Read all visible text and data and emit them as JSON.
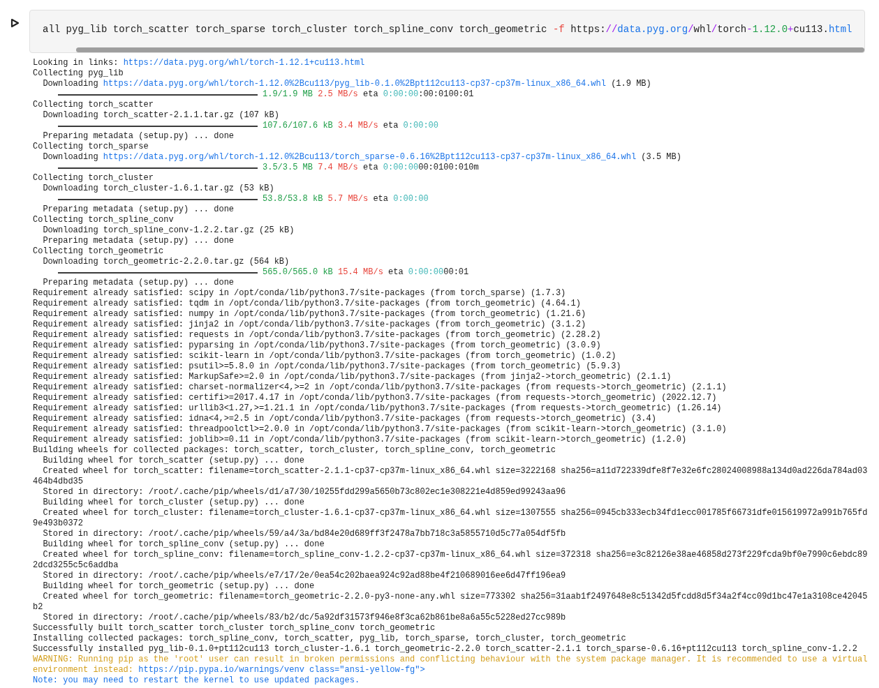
{
  "cell": {
    "command": [
      {
        "kind": "plain",
        "text": "all pyg_lib torch_scatter torch_sparse torch_cluster torch_spline_conv torch_geometric "
      },
      {
        "kind": "red",
        "text": "-f"
      },
      {
        "kind": "plain",
        "text": " https:"
      },
      {
        "kind": "purple",
        "text": "//"
      },
      {
        "kind": "link",
        "text": "data.pyg.org"
      },
      {
        "kind": "purple",
        "text": "/"
      },
      {
        "kind": "plain",
        "text": "whl"
      },
      {
        "kind": "purple",
        "text": "/"
      },
      {
        "kind": "plain",
        "text": "torch"
      },
      {
        "kind": "purple",
        "text": "-"
      },
      {
        "kind": "green",
        "text": "1.12.0"
      },
      {
        "kind": "purple",
        "text": "+"
      },
      {
        "kind": "plain",
        "text": "cu113."
      },
      {
        "kind": "link",
        "text": "html"
      }
    ]
  },
  "output": [
    {
      "kind": "text",
      "segments": [
        {
          "kind": "plain",
          "text": "Looking in links: "
        },
        {
          "kind": "link",
          "text": "https://data.pyg.org/whl/torch-1.12.1+cu113.html"
        }
      ]
    },
    {
      "kind": "text",
      "segments": [
        {
          "kind": "plain",
          "text": "Collecting pyg_lib"
        }
      ]
    },
    {
      "kind": "text",
      "segments": [
        {
          "kind": "plain",
          "text": "  Downloading "
        },
        {
          "kind": "link",
          "text": "https://data.pyg.org/whl/torch-1.12.0%2Bcu113/pyg_lib-0.1.0%2Bpt112cu113-cp37-cp37m-linux_x86_64.whl"
        },
        {
          "kind": "plain",
          "text": " (1.9 MB)"
        }
      ]
    },
    {
      "kind": "progress",
      "level": 1,
      "segments": [
        {
          "kind": "green",
          "text": "1.9/1.9 MB"
        },
        {
          "kind": "red",
          "text": "2.5 MB/s"
        },
        {
          "kind": "plain",
          "text": "eta"
        },
        {
          "kind": "cyan",
          "text": "0:00:00"
        },
        {
          "kind": "plain",
          "text": ":00:0100:01"
        }
      ]
    },
    {
      "kind": "text",
      "segments": [
        {
          "kind": "plain",
          "text": "Collecting torch_scatter"
        }
      ]
    },
    {
      "kind": "text",
      "segments": [
        {
          "kind": "plain",
          "text": "  Downloading torch_scatter-2.1.1.tar.gz (107 kB)"
        }
      ]
    },
    {
      "kind": "progress",
      "level": 1,
      "segments": [
        {
          "kind": "green",
          "text": "107.6/107.6 kB"
        },
        {
          "kind": "red",
          "text": "3.4 MB/s"
        },
        {
          "kind": "plain",
          "text": "eta"
        },
        {
          "kind": "cyan",
          "text": "0:00:00"
        }
      ]
    },
    {
      "kind": "text",
      "segments": [
        {
          "kind": "plain",
          "text": "  Preparing metadata (setup.py) ... done"
        }
      ]
    },
    {
      "kind": "text",
      "segments": [
        {
          "kind": "plain",
          "text": "Collecting torch_sparse"
        }
      ]
    },
    {
      "kind": "text",
      "segments": [
        {
          "kind": "plain",
          "text": "  Downloading "
        },
        {
          "kind": "link",
          "text": "https://data.pyg.org/whl/torch-1.12.0%2Bcu113/torch_sparse-0.6.16%2Bpt112cu113-cp37-cp37m-linux_x86_64.whl"
        },
        {
          "kind": "plain",
          "text": " (3.5 MB)"
        }
      ]
    },
    {
      "kind": "progress",
      "level": 1,
      "segments": [
        {
          "kind": "green",
          "text": "3.5/3.5 MB"
        },
        {
          "kind": "red",
          "text": "7.4 MB/s"
        },
        {
          "kind": "plain",
          "text": "eta"
        },
        {
          "kind": "cyan",
          "text": "0:00:00"
        },
        {
          "kind": "plain",
          "text": "00:0100:010m"
        }
      ]
    },
    {
      "kind": "text",
      "segments": [
        {
          "kind": "plain",
          "text": "Collecting torch_cluster"
        }
      ]
    },
    {
      "kind": "text",
      "segments": [
        {
          "kind": "plain",
          "text": "  Downloading torch_cluster-1.6.1.tar.gz (53 kB)"
        }
      ]
    },
    {
      "kind": "progress",
      "level": 1,
      "segments": [
        {
          "kind": "green",
          "text": "53.8/53.8 kB"
        },
        {
          "kind": "red",
          "text": "5.7 MB/s"
        },
        {
          "kind": "plain",
          "text": "eta"
        },
        {
          "kind": "cyan",
          "text": "0:00:00"
        }
      ]
    },
    {
      "kind": "text",
      "segments": [
        {
          "kind": "plain",
          "text": "  Preparing metadata (setup.py) ... done"
        }
      ]
    },
    {
      "kind": "text",
      "segments": [
        {
          "kind": "plain",
          "text": "Collecting torch_spline_conv"
        }
      ]
    },
    {
      "kind": "text",
      "segments": [
        {
          "kind": "plain",
          "text": "  Downloading torch_spline_conv-1.2.2.tar.gz (25 kB)"
        }
      ]
    },
    {
      "kind": "text",
      "segments": [
        {
          "kind": "plain",
          "text": "  Preparing metadata (setup.py) ... done"
        }
      ]
    },
    {
      "kind": "text",
      "segments": [
        {
          "kind": "plain",
          "text": "Collecting torch_geometric"
        }
      ]
    },
    {
      "kind": "text",
      "segments": [
        {
          "kind": "plain",
          "text": "  Downloading torch_geometric-2.2.0.tar.gz (564 kB)"
        }
      ]
    },
    {
      "kind": "progress",
      "level": 1,
      "segments": [
        {
          "kind": "green",
          "text": "565.0/565.0 kB"
        },
        {
          "kind": "red",
          "text": "15.4 MB/s"
        },
        {
          "kind": "plain",
          "text": "eta"
        },
        {
          "kind": "cyan",
          "text": "0:00:00"
        },
        {
          "kind": "plain",
          "text": "00:01"
        }
      ]
    },
    {
      "kind": "text",
      "segments": [
        {
          "kind": "plain",
          "text": "  Preparing metadata (setup.py) ... done"
        }
      ]
    },
    {
      "kind": "text",
      "segments": [
        {
          "kind": "plain",
          "text": "Requirement already satisfied: scipy in /opt/conda/lib/python3.7/site-packages (from torch_sparse) (1.7.3)"
        }
      ]
    },
    {
      "kind": "text",
      "segments": [
        {
          "kind": "plain",
          "text": "Requirement already satisfied: tqdm in /opt/conda/lib/python3.7/site-packages (from torch_geometric) (4.64.1)"
        }
      ]
    },
    {
      "kind": "text",
      "segments": [
        {
          "kind": "plain",
          "text": "Requirement already satisfied: numpy in /opt/conda/lib/python3.7/site-packages (from torch_geometric) (1.21.6)"
        }
      ]
    },
    {
      "kind": "text",
      "segments": [
        {
          "kind": "plain",
          "text": "Requirement already satisfied: jinja2 in /opt/conda/lib/python3.7/site-packages (from torch_geometric) (3.1.2)"
        }
      ]
    },
    {
      "kind": "text",
      "segments": [
        {
          "kind": "plain",
          "text": "Requirement already satisfied: requests in /opt/conda/lib/python3.7/site-packages (from torch_geometric) (2.28.2)"
        }
      ]
    },
    {
      "kind": "text",
      "segments": [
        {
          "kind": "plain",
          "text": "Requirement already satisfied: pyparsing in /opt/conda/lib/python3.7/site-packages (from torch_geometric) (3.0.9)"
        }
      ]
    },
    {
      "kind": "text",
      "segments": [
        {
          "kind": "plain",
          "text": "Requirement already satisfied: scikit-learn in /opt/conda/lib/python3.7/site-packages (from torch_geometric) (1.0.2)"
        }
      ]
    },
    {
      "kind": "text",
      "segments": [
        {
          "kind": "plain",
          "text": "Requirement already satisfied: psutil>=5.8.0 in /opt/conda/lib/python3.7/site-packages (from torch_geometric) (5.9.3)"
        }
      ]
    },
    {
      "kind": "text",
      "segments": [
        {
          "kind": "plain",
          "text": "Requirement already satisfied: MarkupSafe>=2.0 in /opt/conda/lib/python3.7/site-packages (from jinja2->torch_geometric) (2.1.1)"
        }
      ]
    },
    {
      "kind": "text",
      "segments": [
        {
          "kind": "plain",
          "text": "Requirement already satisfied: charset-normalizer<4,>=2 in /opt/conda/lib/python3.7/site-packages (from requests->torch_geometric) (2.1.1)"
        }
      ]
    },
    {
      "kind": "text",
      "segments": [
        {
          "kind": "plain",
          "text": "Requirement already satisfied: certifi>=2017.4.17 in /opt/conda/lib/python3.7/site-packages (from requests->torch_geometric) (2022.12.7)"
        }
      ]
    },
    {
      "kind": "text",
      "segments": [
        {
          "kind": "plain",
          "text": "Requirement already satisfied: urllib3<1.27,>=1.21.1 in /opt/conda/lib/python3.7/site-packages (from requests->torch_geometric) (1.26.14)"
        }
      ]
    },
    {
      "kind": "text",
      "segments": [
        {
          "kind": "plain",
          "text": "Requirement already satisfied: idna<4,>=2.5 in /opt/conda/lib/python3.7/site-packages (from requests->torch_geometric) (3.4)"
        }
      ]
    },
    {
      "kind": "text",
      "segments": [
        {
          "kind": "plain",
          "text": "Requirement already satisfied: threadpoolctl>=2.0.0 in /opt/conda/lib/python3.7/site-packages (from scikit-learn->torch_geometric) (3.1.0)"
        }
      ]
    },
    {
      "kind": "text",
      "segments": [
        {
          "kind": "plain",
          "text": "Requirement already satisfied: joblib>=0.11 in /opt/conda/lib/python3.7/site-packages (from scikit-learn->torch_geometric) (1.2.0)"
        }
      ]
    },
    {
      "kind": "text",
      "segments": [
        {
          "kind": "plain",
          "text": "Building wheels for collected packages: torch_scatter, torch_cluster, torch_spline_conv, torch_geometric"
        }
      ]
    },
    {
      "kind": "text",
      "segments": [
        {
          "kind": "plain",
          "text": "  Building wheel for torch_scatter (setup.py) ... done"
        }
      ]
    },
    {
      "kind": "text",
      "segments": [
        {
          "kind": "plain",
          "text": "  Created wheel for torch_scatter: filename=torch_scatter-2.1.1-cp37-cp37m-linux_x86_64.whl size=3222168 sha256=a11d722339dfe8f7e32e6fc28024008988a134d0ad226da784ad03"
        }
      ]
    },
    {
      "kind": "text",
      "segments": [
        {
          "kind": "plain",
          "text": "464b4dbd35"
        }
      ]
    },
    {
      "kind": "text",
      "segments": [
        {
          "kind": "plain",
          "text": "  Stored in directory: /root/.cache/pip/wheels/d1/a7/30/10255fdd299a5650b73c802ec1e308221e4d859ed99243aa96"
        }
      ]
    },
    {
      "kind": "text",
      "segments": [
        {
          "kind": "plain",
          "text": "  Building wheel for torch_cluster (setup.py) ... done"
        }
      ]
    },
    {
      "kind": "text",
      "segments": [
        {
          "kind": "plain",
          "text": "  Created wheel for torch_cluster: filename=torch_cluster-1.6.1-cp37-cp37m-linux_x86_64.whl size=1307555 sha256=0945cb333ecb34fd1ecc001785f66731dfe015619972a991b765fd"
        }
      ]
    },
    {
      "kind": "text",
      "segments": [
        {
          "kind": "plain",
          "text": "9e493b0372"
        }
      ]
    },
    {
      "kind": "text",
      "segments": [
        {
          "kind": "plain",
          "text": "  Stored in directory: /root/.cache/pip/wheels/59/a4/3a/bd84e20d689ff3f2478a7bb718c3a5855710d5c77a054df5fb"
        }
      ]
    },
    {
      "kind": "text",
      "segments": [
        {
          "kind": "plain",
          "text": "  Building wheel for torch_spline_conv (setup.py) ... done"
        }
      ]
    },
    {
      "kind": "text",
      "segments": [
        {
          "kind": "plain",
          "text": "  Created wheel for torch_spline_conv: filename=torch_spline_conv-1.2.2-cp37-cp37m-linux_x86_64.whl size=372318 sha256=e3c82126e38ae46858d273f229fcda9bf0e7990c6ebdc89"
        }
      ]
    },
    {
      "kind": "text",
      "segments": [
        {
          "kind": "plain",
          "text": "2dcd3255c5c6addba"
        }
      ]
    },
    {
      "kind": "text",
      "segments": [
        {
          "kind": "plain",
          "text": "  Stored in directory: /root/.cache/pip/wheels/e7/17/2e/0ea54c202baea924c92ad88be4f210689016ee6d47ff196ea9"
        }
      ]
    },
    {
      "kind": "text",
      "segments": [
        {
          "kind": "plain",
          "text": "  Building wheel for torch_geometric (setup.py) ... done"
        }
      ]
    },
    {
      "kind": "text",
      "segments": [
        {
          "kind": "plain",
          "text": "  Created wheel for torch_geometric: filename=torch_geometric-2.2.0-py3-none-any.whl size=773302 sha256=31aab1f2497648e8c51342d5fcdd8d5f34a2f4cc09d1bc47e1a3108ce42045"
        }
      ]
    },
    {
      "kind": "text",
      "segments": [
        {
          "kind": "plain",
          "text": "b2"
        }
      ]
    },
    {
      "kind": "text",
      "segments": [
        {
          "kind": "plain",
          "text": "  Stored in directory: /root/.cache/pip/wheels/83/b2/dc/5a92df31573f946e8f3ca62b861be8a6a55c5228ed27cc989b"
        }
      ]
    },
    {
      "kind": "text",
      "segments": [
        {
          "kind": "plain",
          "text": "Successfully built torch_scatter torch_cluster torch_spline_conv torch_geometric"
        }
      ]
    },
    {
      "kind": "text",
      "segments": [
        {
          "kind": "plain",
          "text": "Installing collected packages: torch_spline_conv, torch_scatter, pyg_lib, torch_sparse, torch_cluster, torch_geometric"
        }
      ]
    },
    {
      "kind": "text",
      "segments": [
        {
          "kind": "plain",
          "text": "Successfully installed pyg_lib-0.1.0+pt112cu113 torch_cluster-1.6.1 torch_geometric-2.2.0 torch_scatter-2.1.1 torch_sparse-0.6.16+pt112cu113 torch_spline_conv-1.2.2"
        }
      ]
    },
    {
      "kind": "text",
      "segments": [
        {
          "kind": "yellow",
          "text": "WARNING: Running pip as the 'root' user can result in broken permissions and conflicting behaviour with the system package manager. It is recommended to use a virtual"
        }
      ]
    },
    {
      "kind": "text",
      "segments": [
        {
          "kind": "yellow",
          "text": "environment instead: "
        },
        {
          "kind": "link",
          "text": "https://pip.pypa.io/warnings/venv class=\"ansi-yellow-fg\">"
        }
      ]
    },
    {
      "kind": "text",
      "segments": [
        {
          "kind": "blue",
          "text": "Note: you may need to restart the kernel to use updated packages."
        }
      ]
    }
  ]
}
